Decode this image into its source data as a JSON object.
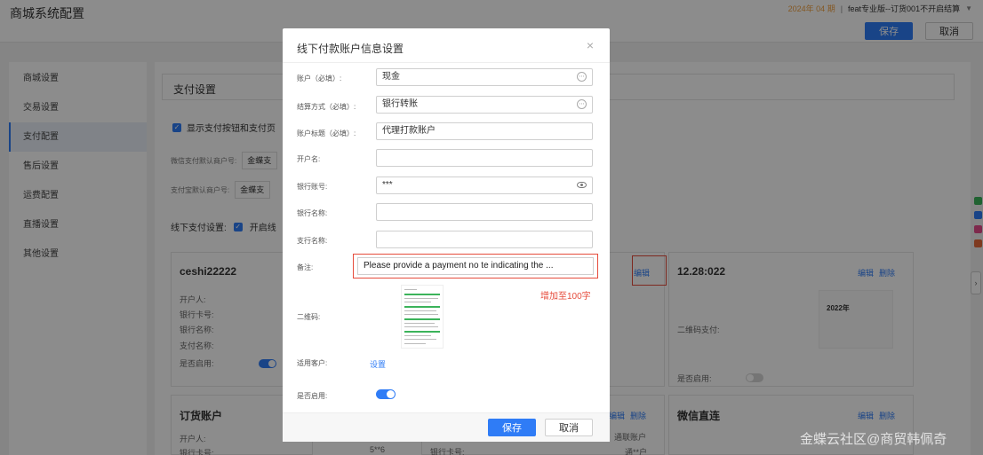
{
  "header": {
    "title": "商城系统配置",
    "period": "2024年 04 期",
    "separator": "|",
    "org": "feat专业版--订货001不开启结算",
    "save_label": "保存",
    "cancel_label": "取消"
  },
  "sidebar": {
    "items": [
      {
        "label": "商城设置"
      },
      {
        "label": "交易设置"
      },
      {
        "label": "支付配置"
      },
      {
        "label": "售后设置"
      },
      {
        "label": "运费配置"
      },
      {
        "label": "直播设置"
      },
      {
        "label": "其他设置"
      }
    ]
  },
  "main": {
    "section_title": "支付设置",
    "show_pay_label": "显示支付按钮和支付页",
    "wechat_label": "微信支付默认商户号:",
    "wechat_value": "金蝶支",
    "alipay_label": "支付宝默认商户号:",
    "alipay_value": "金蝶支",
    "offline_label": "线下支付设置:",
    "offline_enable": "开启线"
  },
  "cards": {
    "c1": {
      "title": "ceshi22222",
      "l1": "开户人:",
      "l2": "银行卡号:",
      "l3": "银行名称:",
      "l4": "支付名称:",
      "l5": "是否启用:"
    },
    "c2": {
      "edit": "编辑"
    },
    "c3": {
      "title": "12.28:022",
      "edit": "编辑",
      "del": "删除",
      "qr_label": "二维码支付:",
      "enabled_label": "是否启用:",
      "year": "2022年"
    },
    "c4": {
      "title": "订货账户",
      "l1": "开户人:",
      "l2": "银行卡号:",
      "val": "5**6"
    },
    "c5": {
      "edit": "编辑",
      "del": "删除",
      "l1": "银行卡号:",
      "v1": "通联账户",
      "v2": "通**户"
    },
    "c6": {
      "title": "微信直连",
      "edit": "编辑",
      "del": "删除"
    }
  },
  "modal": {
    "title": "线下付款账户信息设置",
    "close": "×",
    "fields": {
      "account_label": "账户（必填）:",
      "account_value": "现金",
      "settle_label": "结算方式（必填）:",
      "settle_value": "银行转账",
      "acc_title_label": "账户标题（必填）:",
      "acc_title_value": "代理打款账户",
      "holder_label": "开户名:",
      "bank_no_label": "银行账号:",
      "bank_no_value": "***",
      "bank_name_label": "银行名称:",
      "branch_label": "支行名称:",
      "note_label": "备注:",
      "note_value": "Please provide a payment no te indicating the ...",
      "note_hint": "增加至100字",
      "qr_label": "二维码:",
      "customer_label": "适用客户:",
      "customer_link": "设置",
      "enabled_label": "是否启用:"
    },
    "save_label": "保存",
    "cancel_label": "取消"
  },
  "watermark": "金蝶云社区@商贸韩佩奇",
  "colors": {
    "accent": "#2f7cf6",
    "warning": "#e64b3b",
    "period": "#f0a040"
  }
}
